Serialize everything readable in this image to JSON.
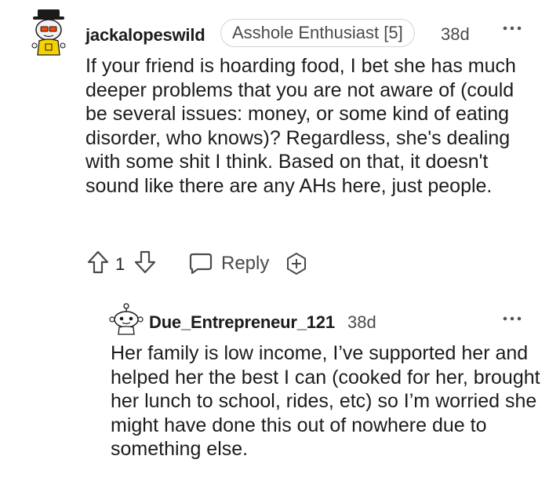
{
  "comment": {
    "username": "jackalopeswild",
    "flair": "Asshole Enthusiast [5]",
    "age": "38d",
    "body": "If your friend is hoarding food, I bet she has much deeper problems that you are not aware of (could be several issues: money, or some kind of eating disorder, who knows)? Regardless, she's dealing with some shit I think. Based on that, it doesn't sound like there are any AHs here, just people.",
    "score": "1",
    "reply_label": "Reply"
  },
  "reply": {
    "username": "Due_Entrepreneur_121",
    "age": "38d",
    "body": "Her family is low income, I’ve supported her and helped her the best I can (cooked for her, brought her lunch to school, rides, etc) so I’m worried she might have done this out of nowhere due to something else."
  },
  "icons": {
    "upvote": "upvote-arrow-icon",
    "downvote": "downvote-arrow-icon",
    "reply": "speech-bubble-icon",
    "award": "award-plus-icon",
    "more": "more-dots-icon"
  },
  "colors": {
    "text": "#1c1c1c",
    "muted": "#4a4a4a",
    "flair_border": "#cfd3d6",
    "avatar_main_yellow": "#f5d300",
    "avatar_hat": "#1a1a1a"
  }
}
